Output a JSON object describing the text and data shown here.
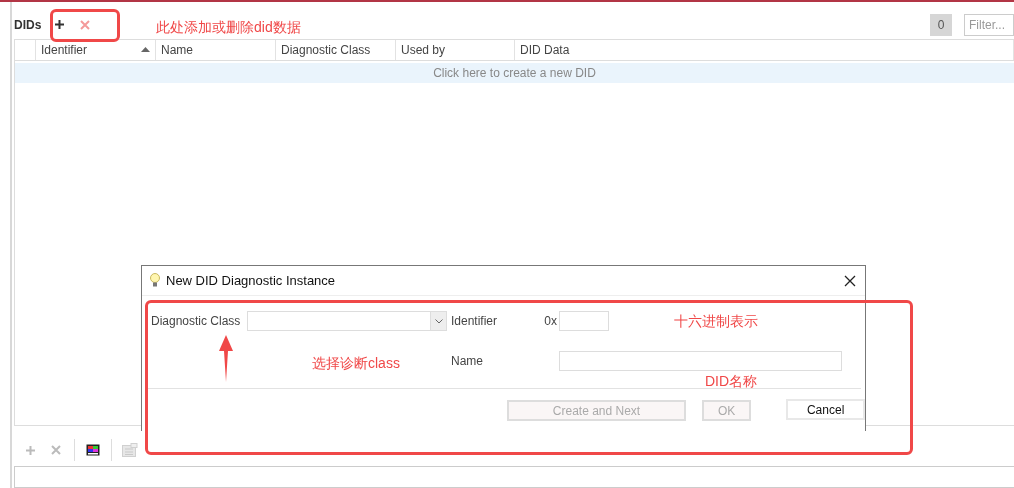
{
  "panel": {
    "title": "DIDs",
    "count": "0",
    "filter_placeholder": "Filter..."
  },
  "top_actions": [
    {
      "kind": "add",
      "disabled": false
    },
    {
      "kind": "remove",
      "disabled": true
    }
  ],
  "table": {
    "columns": [
      {
        "label": "Identifier",
        "sorted": true
      },
      {
        "label": "Name",
        "sorted": false
      },
      {
        "label": "Diagnostic Class",
        "sorted": false
      },
      {
        "label": "Used by",
        "sorted": false
      },
      {
        "label": "DID Data",
        "sorted": false
      }
    ],
    "new_row_hint": "Click here to create a new DID"
  },
  "bottom_actions": [
    {
      "kind": "add",
      "disabled": true
    },
    {
      "kind": "remove",
      "disabled": true
    },
    {
      "kind": "palette",
      "disabled": false
    },
    {
      "kind": "list",
      "disabled": true
    }
  ],
  "dialog": {
    "title": "New DID Diagnostic Instance",
    "diagnostic_class_label": "Diagnostic Class",
    "identifier_label": "Identifier",
    "hex_prefix": "0x",
    "name_label": "Name",
    "buttons": [
      {
        "label": "Create and Next",
        "disabled": true
      },
      {
        "label": "OK",
        "disabled": true
      },
      {
        "label": "Cancel",
        "disabled": false
      }
    ]
  },
  "annotations": [
    {
      "text": "此处添加或删除did数据"
    },
    {
      "text": "选择诊断class"
    },
    {
      "text": "十六进制表示"
    },
    {
      "text": "DID名称"
    }
  ]
}
